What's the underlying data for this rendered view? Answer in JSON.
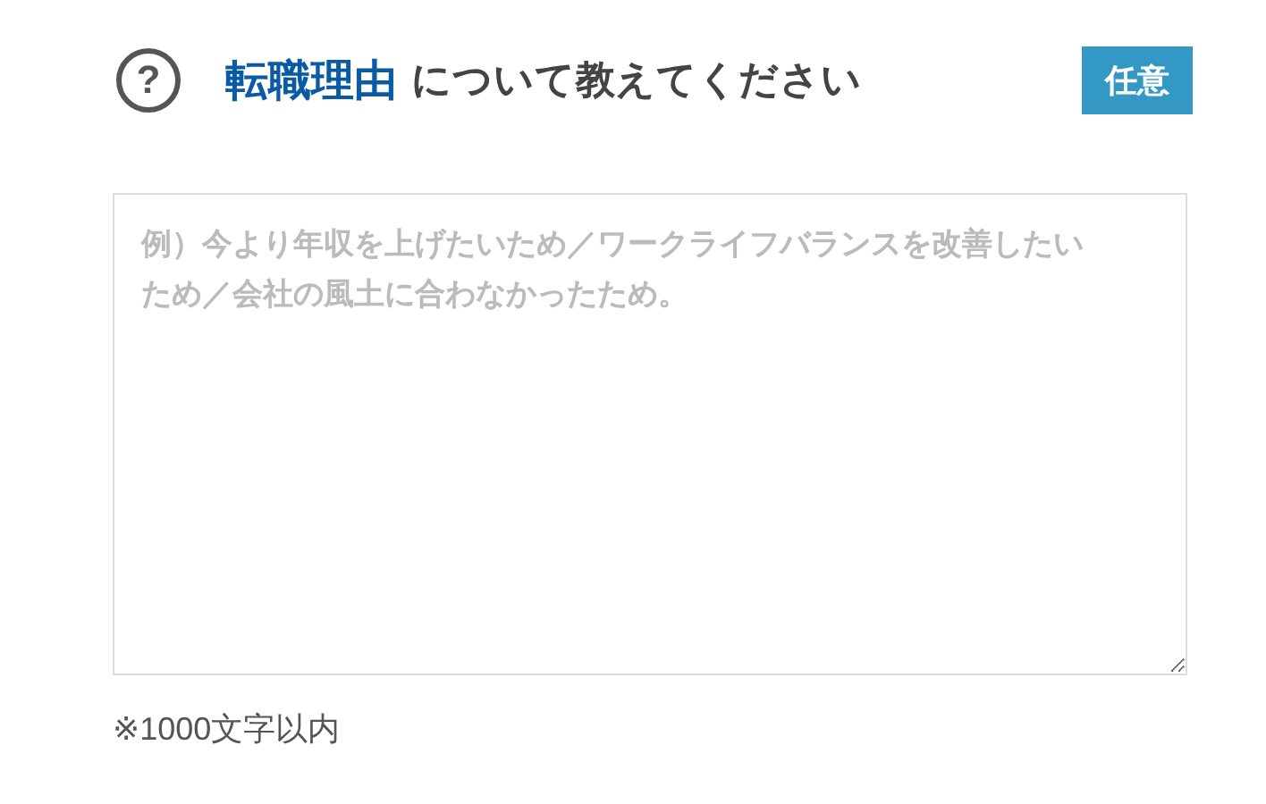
{
  "heading": {
    "icon": "?",
    "keyword": "転職理由",
    "rest": "について教えてください",
    "badge": "任意"
  },
  "reason_field": {
    "placeholder": "例）今より年収を上げたいため／ワークライフバランスを改善したいため／会社の風土に合わなかったため。"
  },
  "note": "※1000文字以内"
}
